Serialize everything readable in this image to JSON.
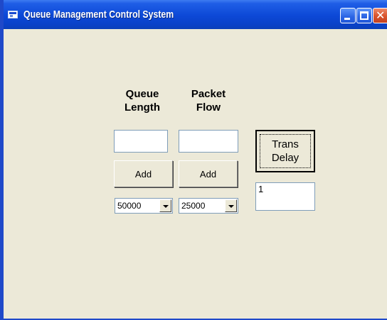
{
  "window": {
    "title": "Queue Management Control System",
    "icons": {
      "app": "app-window-icon",
      "minimize": "minimize-icon",
      "maximize": "maximize-icon",
      "close": "close-icon"
    }
  },
  "labels": {
    "queue_length": "Queue\nLength",
    "packet_flow": "Packet\nFlow"
  },
  "inputs": {
    "queue_length_value": "",
    "packet_flow_value": "",
    "trans_delay_value": "1"
  },
  "buttons": {
    "add_queue": "Add",
    "add_packet": "Add",
    "trans_delay": "Trans\nDelay"
  },
  "combos": {
    "queue_length_selected": "50000",
    "packet_flow_selected": "25000"
  },
  "colors": {
    "titlebar": "#0c48d6",
    "face": "#ece9d8",
    "close": "#d9532c"
  }
}
